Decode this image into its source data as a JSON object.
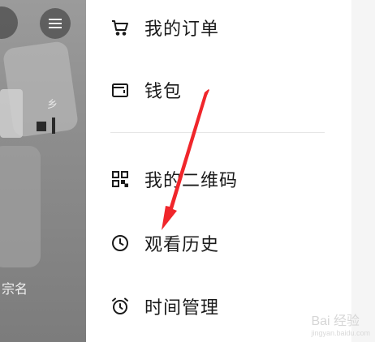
{
  "menu": {
    "items": [
      {
        "label": "我的订单",
        "icon": "cart-icon"
      },
      {
        "label": "钱包",
        "icon": "wallet-icon"
      },
      {
        "label": "我的二维码",
        "icon": "qrcode-icon"
      },
      {
        "label": "观看历史",
        "icon": "clock-icon"
      },
      {
        "label": "时间管理",
        "icon": "alarm-icon"
      }
    ]
  },
  "background": {
    "fragment_top": "乡",
    "fragment_bottom": "宗名"
  },
  "watermark": {
    "brand": "Bai 经验",
    "url": "jingyan.baidu.com"
  },
  "colors": {
    "arrow": "#f0262b",
    "text": "#1a1a1a",
    "overlay": "#8e8e8e"
  }
}
